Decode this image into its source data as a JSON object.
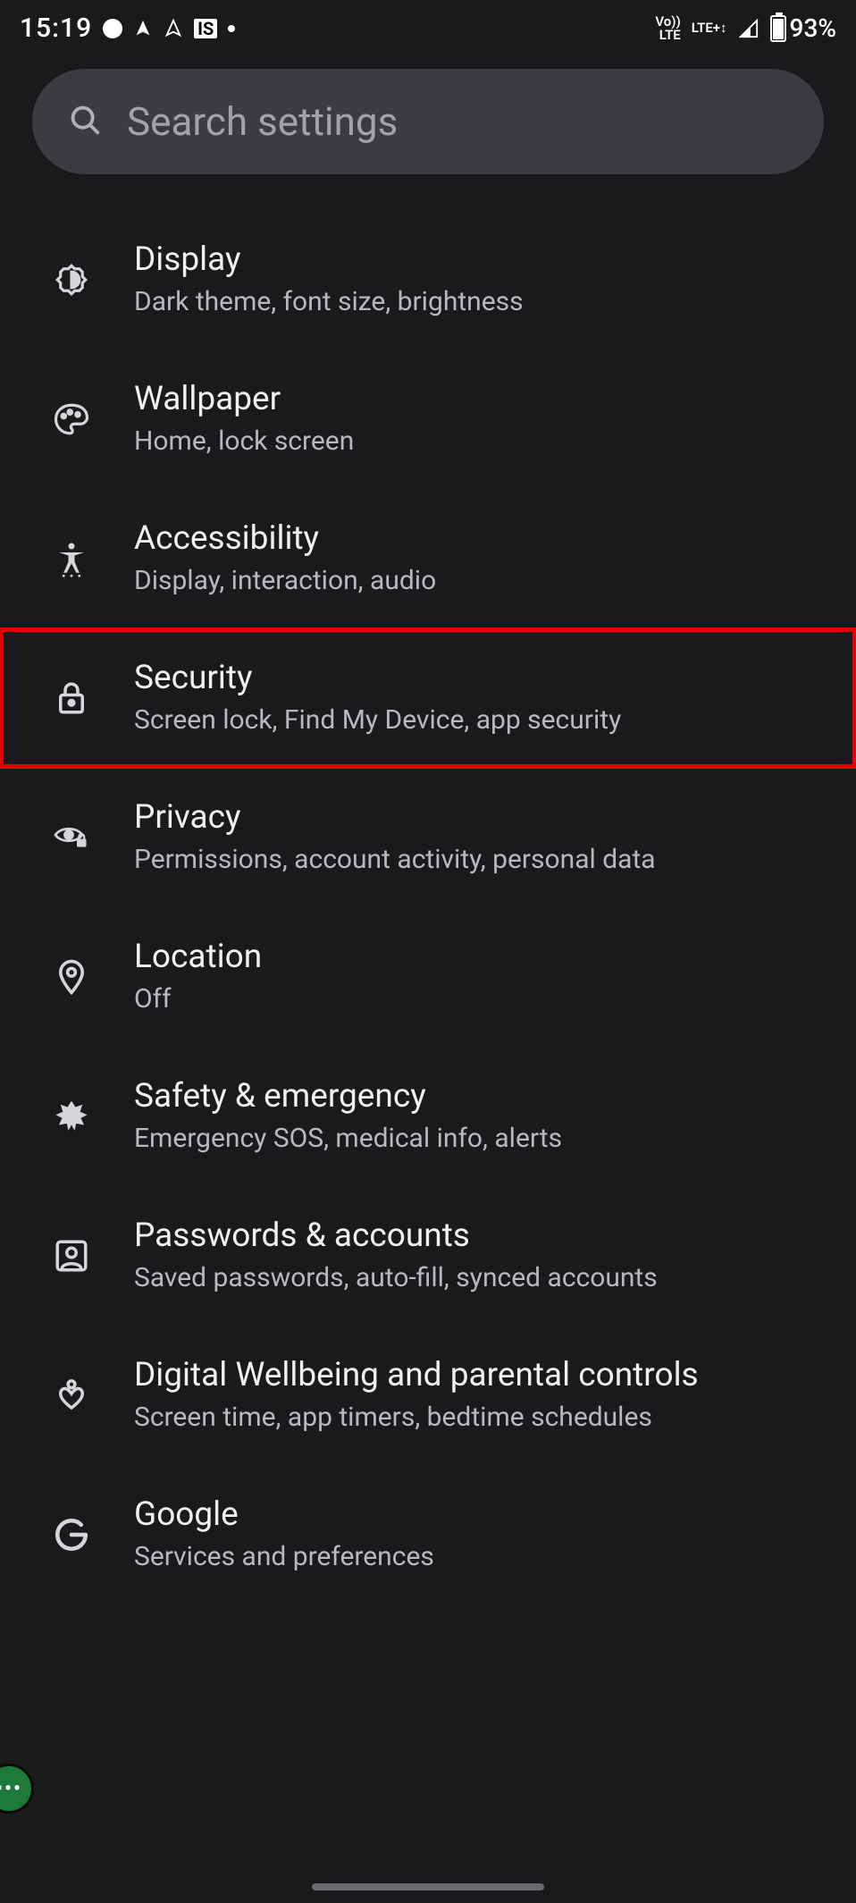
{
  "status_bar": {
    "time": "15:19",
    "is_badge": "IS",
    "net_label_top": "Vo))",
    "net_label_bottom": "LTE",
    "net_label_right": "LTE+↕",
    "battery_percent": "93%"
  },
  "search": {
    "placeholder": "Search settings"
  },
  "settings": [
    {
      "key": "display",
      "title": "Display",
      "subtitle": "Dark theme, font size, brightness",
      "icon": "brightness-icon",
      "highlighted": false
    },
    {
      "key": "wallpaper",
      "title": "Wallpaper",
      "subtitle": "Home, lock screen",
      "icon": "palette-icon",
      "highlighted": false
    },
    {
      "key": "accessibility",
      "title": "Accessibility",
      "subtitle": "Display, interaction, audio",
      "icon": "accessibility-icon",
      "highlighted": false
    },
    {
      "key": "security",
      "title": "Security",
      "subtitle": "Screen lock, Find My Device, app security",
      "icon": "lock-icon",
      "highlighted": true
    },
    {
      "key": "privacy",
      "title": "Privacy",
      "subtitle": "Permissions, account activity, personal data",
      "icon": "privacy-eye-icon",
      "highlighted": false
    },
    {
      "key": "location",
      "title": "Location",
      "subtitle": "Off",
      "icon": "location-pin-icon",
      "highlighted": false
    },
    {
      "key": "safety",
      "title": "Safety & emergency",
      "subtitle": "Emergency SOS, medical info, alerts",
      "icon": "medical-star-icon",
      "highlighted": false
    },
    {
      "key": "passwords",
      "title": "Passwords & accounts",
      "subtitle": "Saved passwords, auto-fill, synced accounts",
      "icon": "account-box-icon",
      "highlighted": false
    },
    {
      "key": "wellbeing",
      "title": "Digital Wellbeing and parental controls",
      "subtitle": "Screen time, app timers, bedtime schedules",
      "icon": "wellbeing-icon",
      "highlighted": false
    },
    {
      "key": "google",
      "title": "Google",
      "subtitle": "Services and preferences",
      "icon": "google-g-icon",
      "highlighted": false
    }
  ]
}
